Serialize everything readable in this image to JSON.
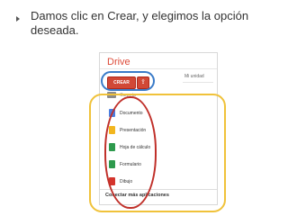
{
  "slide": {
    "bullet_text": "Damos clic en Crear, y elegimos la opción deseada."
  },
  "drive": {
    "title": "Drive",
    "create_button": "CREAR",
    "upload_icon": "upload-icon",
    "my_drive_label": "Mi unidad",
    "folder_label": "Carpeta"
  },
  "menu": {
    "items": [
      {
        "label": "Documento",
        "icon": "document-icon",
        "color": "#4a7ee0"
      },
      {
        "label": "Presentación",
        "icon": "presentation-icon",
        "color": "#f2b61f"
      },
      {
        "label": "Hoja de cálculo",
        "icon": "spreadsheet-icon",
        "color": "#2e9a4d"
      },
      {
        "label": "Formulario",
        "icon": "form-icon",
        "color": "#2e9a4d"
      },
      {
        "label": "Dibujo",
        "icon": "drawing-icon",
        "color": "#d4342c"
      }
    ],
    "connect_label": "Conectar más aplicaciones"
  },
  "annotation_colors": {
    "create_highlight": "#3a7bc8",
    "menu_highlight": "#f0c23a",
    "items_highlight": "#c0302a"
  }
}
